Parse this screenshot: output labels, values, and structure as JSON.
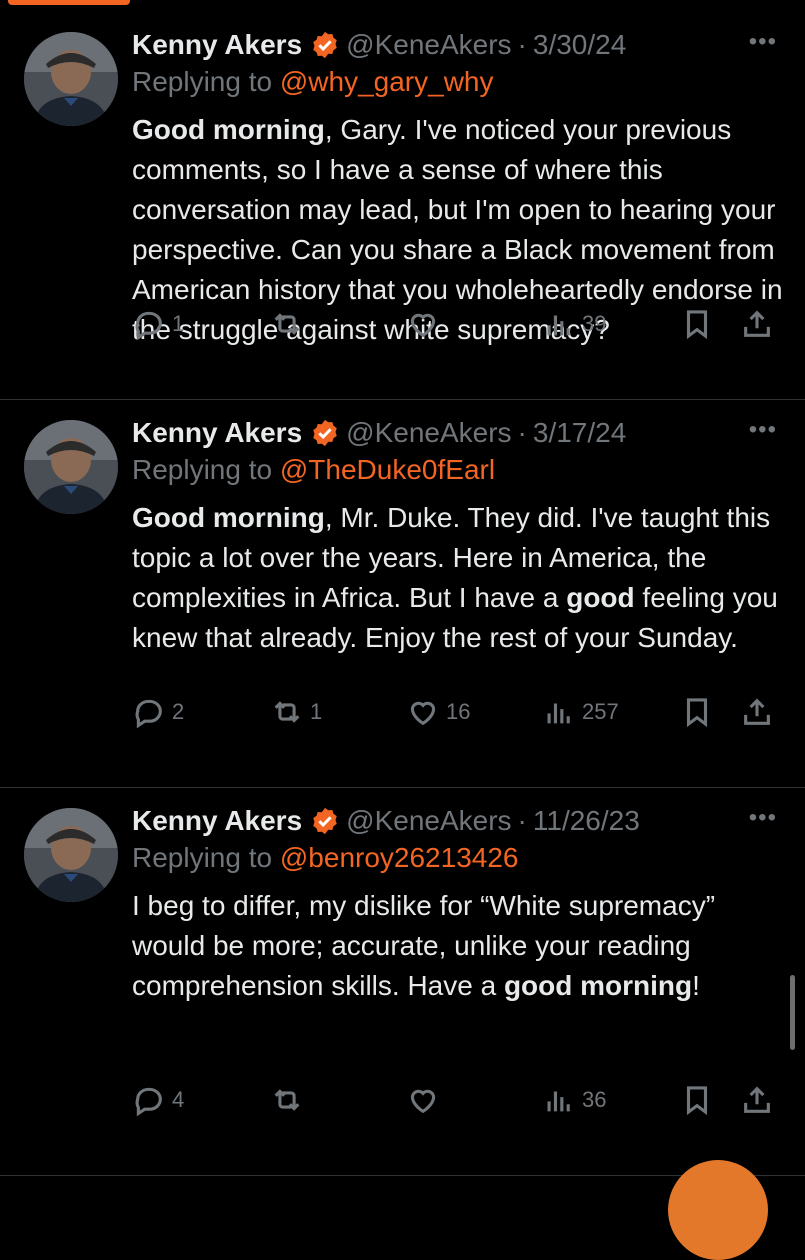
{
  "accent_color": "#f26522",
  "tweets": [
    {
      "author_name": "Kenny Akers",
      "handle": "@KeneAkers",
      "separator": "·",
      "date": "3/30/24",
      "more": "•••",
      "replying_label": "Replying to",
      "replying_to": "@why_gary_why",
      "body_bold_1": "Good morning",
      "body_text_1": ", Gary. I've noticed your previous comments, so I have a sense of where this conversation may lead, but I'm open to hearing your perspective. Can you share a Black movement from American history that you wholeheartedly endorse in the struggle against white supremacy?",
      "replies": "1",
      "reposts": "",
      "likes": "",
      "views": "39"
    },
    {
      "author_name": "Kenny Akers",
      "handle": "@KeneAkers",
      "separator": "·",
      "date": "3/17/24",
      "more": "•••",
      "replying_label": "Replying to",
      "replying_to": "@TheDuke0fEarl",
      "body_bold_1": "Good morning",
      "body_text_1": ", Mr. Duke. They did. I've taught this topic a lot over the years. Here in America, the complexities in Africa. But I have a ",
      "body_bold_2": "good",
      "body_text_2": " feeling you knew that already. Enjoy the rest of your Sunday.",
      "replies": "2",
      "reposts": "1",
      "likes": "16",
      "views": "257"
    },
    {
      "author_name": "Kenny Akers",
      "handle": "@KeneAkers",
      "separator": "·",
      "date": "11/26/23",
      "more": "•••",
      "replying_label": "Replying to",
      "replying_to": "@benroy26213426",
      "body_text_1": "I beg to differ, my dislike for “White supremacy” would be more; accurate, unlike your reading comprehension skills. Have a ",
      "body_bold_2": "good morning",
      "body_text_2": "!",
      "replies": "4",
      "reposts": "",
      "likes": "",
      "views": "36"
    }
  ]
}
